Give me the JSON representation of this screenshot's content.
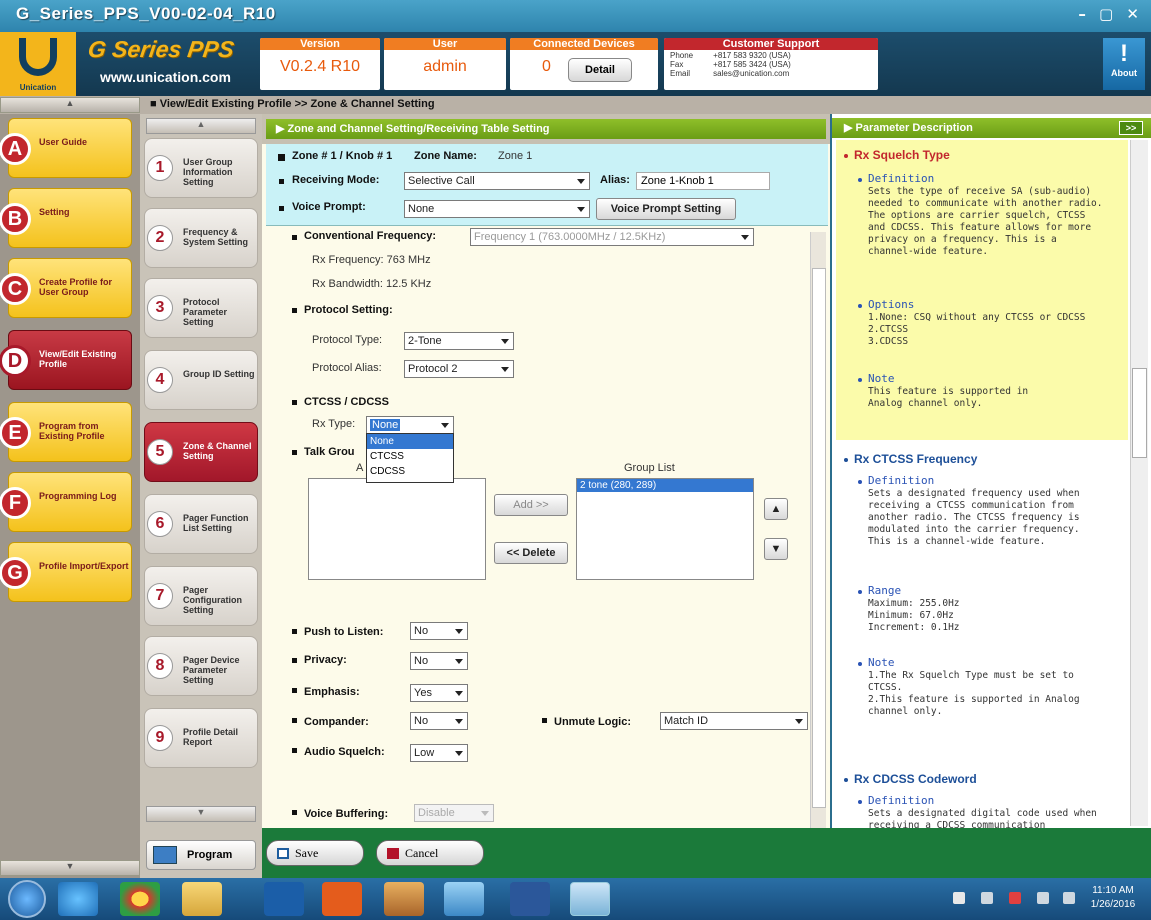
{
  "window": {
    "title": "G_Series_PPS_V00-02-04_R10",
    "controls": "– ▢ ✕"
  },
  "header": {
    "logo_text": "Unication",
    "brand": "G Series PPS",
    "url": "www.unication.com",
    "version": {
      "label": "Version",
      "value": "V0.2.4 R10"
    },
    "user": {
      "label": "User",
      "value": "admin"
    },
    "devices": {
      "label": "Connected Devices",
      "value": "0",
      "detail_button": "Detail"
    },
    "support": {
      "label": "Customer Support",
      "phone_label": "Phone",
      "fax_label": "Fax",
      "email_label": "Email",
      "phone": "+817 583 9320 (USA)",
      "fax": "+817 585 3424 (USA)",
      "email": "sales@unication.com"
    },
    "about": {
      "label": "About",
      "glyph": "!"
    }
  },
  "breadcrumb": "View/Edit Existing Profile >> Zone & Channel Setting",
  "nav": [
    {
      "letter": "A",
      "label": "User Guide"
    },
    {
      "letter": "B",
      "label": "Setting"
    },
    {
      "letter": "C",
      "label": "Create Profile for User Group"
    },
    {
      "letter": "D",
      "label": "View/Edit Existing Profile",
      "active": true
    },
    {
      "letter": "E",
      "label": "Program from Existing Profile"
    },
    {
      "letter": "F",
      "label": "Programming Log"
    },
    {
      "letter": "G",
      "label": "Profile Import/Export"
    }
  ],
  "steps": [
    {
      "num": "1",
      "label": "User Group Information Setting"
    },
    {
      "num": "2",
      "label": "Frequency & System Setting"
    },
    {
      "num": "3",
      "label": "Protocol Parameter Setting"
    },
    {
      "num": "4",
      "label": "Group ID Setting"
    },
    {
      "num": "5",
      "label": "Zone & Channel Setting",
      "active": true
    },
    {
      "num": "6",
      "label": "Pager Function List Setting"
    },
    {
      "num": "7",
      "label": "Pager Configuration Setting"
    },
    {
      "num": "8",
      "label": "Pager Device Parameter Setting"
    },
    {
      "num": "9",
      "label": "Profile Detail Report"
    }
  ],
  "program_button": "Program",
  "main": {
    "panel_title": "Zone and Channel Setting/Receiving Table Setting",
    "zone": {
      "zone_knob": "Zone # 1 / Knob # 1",
      "zone_name_label": "Zone Name:",
      "zone_name": "Zone 1"
    },
    "receiving_mode": {
      "label": "Receiving Mode:",
      "value": "Selective Call"
    },
    "alias": {
      "label": "Alias:",
      "value": "Zone 1-Knob 1"
    },
    "voice_prompt": {
      "label": "Voice Prompt:",
      "value": "None",
      "button": "Voice Prompt Setting"
    },
    "conventional_frequency": {
      "label": "Conventional Frequency:",
      "value": "Frequency 1 (763.0000MHz / 12.5KHz)"
    },
    "rx_frequency": "Rx Frequency: 763  MHz",
    "rx_bandwidth": "Rx Bandwidth: 12.5 KHz",
    "protocol_setting": "Protocol Setting:",
    "protocol_type": {
      "label": "Protocol Type:",
      "value": "2-Tone"
    },
    "protocol_alias": {
      "label": "Protocol Alias:",
      "value": "Protocol 2"
    },
    "ctcss_heading": "CTCSS / CDCSS",
    "rx_type": {
      "label": "Rx Type:",
      "value": "None",
      "options": [
        "None",
        "CTCSS",
        "CDCSS"
      ]
    },
    "talk_group_label": "Talk Grou",
    "available_label": "A",
    "group_list_label": "Group List",
    "group_list_items": [
      "2 tone (280, 289)"
    ],
    "add_button": "Add >>",
    "delete_button": "<< Delete",
    "push_to_listen": {
      "label": "Push to Listen:",
      "value": "No"
    },
    "privacy": {
      "label": "Privacy:",
      "value": "No"
    },
    "emphasis": {
      "label": "Emphasis:",
      "value": "Yes"
    },
    "compander": {
      "label": "Compander:",
      "value": "No"
    },
    "unmute_logic": {
      "label": "Unmute Logic:",
      "value": "Match ID"
    },
    "audio_squelch": {
      "label": "Audio Squelch:",
      "value": "Low"
    },
    "voice_buffering": {
      "label": "Voice Buffering:",
      "value": "Disable"
    }
  },
  "bottom": {
    "save": "Save",
    "cancel": "Cancel"
  },
  "param": {
    "header": "Parameter Description",
    "more": ">>",
    "rx_squelch": {
      "title": "Rx Squelch Type",
      "def_label": "Definition",
      "def": "Sets the type of receive SA (sub-audio) needed to communicate with another radio. The options are carrier squelch, CTCSS and CDCSS. This feature allows for more privacy on a frequency. This is a channel-wide feature.",
      "opt_label": "Options",
      "options": [
        "1.None: CSQ without any CTCSS or CDCSS",
        "2.CTCSS",
        "3.CDCSS"
      ],
      "note_label": "Note",
      "note": "This feature is supported in Analog channel only."
    },
    "rx_ctcss": {
      "title": "Rx CTCSS Frequency",
      "def_label": "Definition",
      "def": "Sets a designated frequency used when receiving a CTCSS communication from another radio. The CTCSS frequency is modulated into the carrier frequency. This is a channel-wide feature.",
      "range_label": "Range",
      "range": [
        "Maximum: 255.0Hz",
        "Minimum: 67.0Hz",
        "Increment: 0.1Hz"
      ],
      "note_label": "Note",
      "note": [
        "1.The Rx Squelch Type must be set to CTCSS.",
        "2.This feature is supported in Analog channel only."
      ]
    },
    "rx_cdcss": {
      "title": "Rx CDCSS Codeword",
      "def_label": "Definition",
      "def": "Sets a designated digital code used when receiving a CDCSS communication"
    }
  },
  "taskbar": {
    "time": "11:10 AM",
    "date": "1/26/2016"
  }
}
